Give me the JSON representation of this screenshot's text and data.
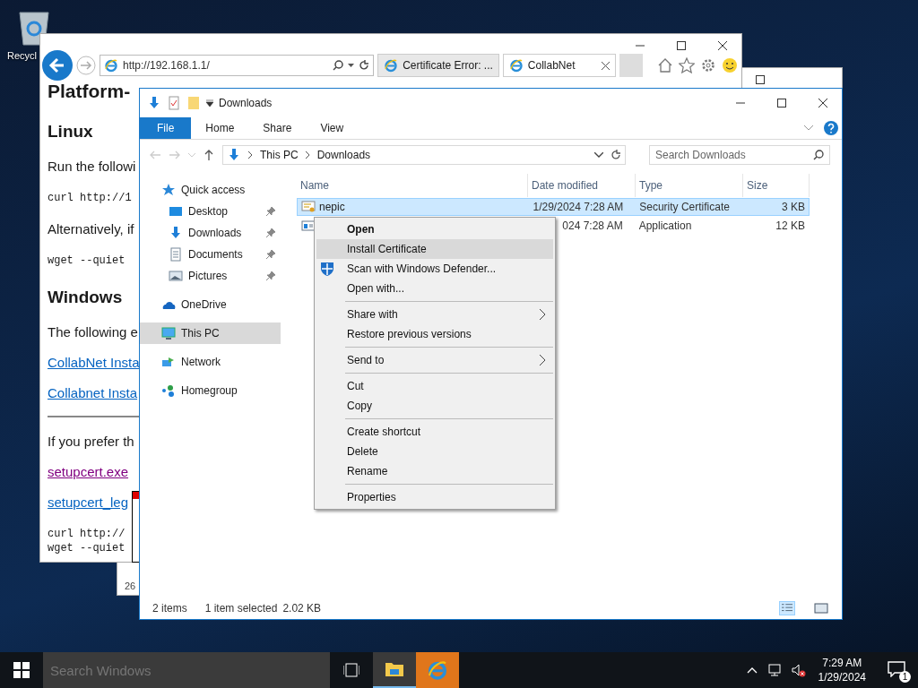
{
  "desktop": {
    "icons": [
      {
        "label": "Recycl"
      }
    ]
  },
  "browser": {
    "address": "http://192.168.1.1/",
    "tabs": [
      {
        "label": "Certificate Error: ...",
        "selected": false
      },
      {
        "label": "CollabNet",
        "selected": true
      }
    ],
    "page": [
      {
        "kind": "h1",
        "text": "Platform-"
      },
      {
        "kind": "h2",
        "text": "Linux"
      },
      {
        "kind": "p",
        "text": "Run the followi"
      },
      {
        "kind": "code",
        "text": "curl http://1"
      },
      {
        "kind": "p",
        "text": "Alternatively, if"
      },
      {
        "kind": "code",
        "text": "wget --quiet"
      },
      {
        "kind": "h2",
        "text": "Windows"
      },
      {
        "kind": "p",
        "text": "The following e"
      },
      {
        "kind": "link",
        "text": "CollabNet Insta",
        "visited": false
      },
      {
        "kind": "link",
        "text": "Collabnet Insta",
        "visited": false
      },
      {
        "kind": "hr"
      },
      {
        "kind": "p",
        "text": "If you prefer th"
      },
      {
        "kind": "link",
        "text": "setupcert.exe",
        "visited": true
      },
      {
        "kind": "link",
        "text": "setupcert_leg",
        "visited": false
      },
      {
        "kind": "code",
        "text": "curl http://"
      },
      {
        "kind": "code",
        "text": "wget --quiet"
      }
    ]
  },
  "background_window": {
    "status": "26"
  },
  "explorer": {
    "title": "Downloads",
    "ribbon_tabs": [
      {
        "label": "File",
        "selected": true
      },
      {
        "label": "Home",
        "selected": false
      },
      {
        "label": "Share",
        "selected": false
      },
      {
        "label": "View",
        "selected": false
      }
    ],
    "breadcrumb": [
      "This PC",
      "Downloads"
    ],
    "search": {
      "placeholder": "Search Downloads"
    },
    "nav": [
      {
        "label": "Quick access",
        "pinned": false,
        "selected": false,
        "children": [
          {
            "label": "Desktop",
            "pinned": true,
            "selected": false
          },
          {
            "label": "Downloads",
            "pinned": true,
            "selected": false
          },
          {
            "label": "Documents",
            "pinned": true,
            "selected": false
          },
          {
            "label": "Pictures",
            "pinned": true,
            "selected": false
          }
        ]
      },
      {
        "label": "OneDrive",
        "pinned": false,
        "selected": false
      },
      {
        "label": "This PC",
        "pinned": false,
        "selected": true
      },
      {
        "label": "Network",
        "pinned": false,
        "selected": false
      },
      {
        "label": "Homegroup",
        "pinned": false,
        "selected": false
      }
    ],
    "columns": [
      "Name",
      "Date modified",
      "Type",
      "Size"
    ],
    "rows": [
      {
        "kind": "certificate",
        "name": "nepic",
        "date": "1/29/2024 7:28 AM",
        "type": "Security Certificate",
        "size": "3 KB",
        "selected": true
      },
      {
        "kind": "application",
        "date": "024 7:28 AM",
        "type": "Application",
        "size": "12 KB",
        "selected": false
      }
    ],
    "status": {
      "count": "2 items",
      "selection": "1 item selected",
      "selection_size": "2.02 KB"
    },
    "views": [
      {
        "kind": "details",
        "selected": true
      },
      {
        "kind": "tiles",
        "selected": false
      }
    ]
  },
  "context_menu": {
    "items": [
      {
        "kind": "item",
        "label": "Open",
        "bold": true,
        "highlighted": false
      },
      {
        "kind": "item",
        "label": "Install Certificate",
        "bold": false,
        "highlighted": true
      },
      {
        "kind": "item",
        "label": "Scan with Windows Defender...",
        "bold": false,
        "highlighted": false,
        "icon": true
      },
      {
        "kind": "item",
        "label": "Open with...",
        "bold": false,
        "highlighted": false
      },
      {
        "kind": "separator"
      },
      {
        "kind": "item",
        "label": "Share with",
        "bold": false,
        "highlighted": false,
        "submenu": true
      },
      {
        "kind": "item",
        "label": "Restore previous versions",
        "bold": false,
        "highlighted": false
      },
      {
        "kind": "separator"
      },
      {
        "kind": "item",
        "label": "Send to",
        "bold": false,
        "highlighted": false,
        "submenu": true
      },
      {
        "kind": "separator"
      },
      {
        "kind": "item",
        "label": "Cut",
        "bold": false,
        "highlighted": false
      },
      {
        "kind": "item",
        "label": "Copy",
        "bold": false,
        "highlighted": false
      },
      {
        "kind": "separator"
      },
      {
        "kind": "item",
        "label": "Create shortcut",
        "bold": false,
        "highlighted": false
      },
      {
        "kind": "item",
        "label": "Delete",
        "bold": false,
        "highlighted": false
      },
      {
        "kind": "item",
        "label": "Rename",
        "bold": false,
        "highlighted": false
      },
      {
        "kind": "separator"
      },
      {
        "kind": "item",
        "label": "Properties",
        "bold": false,
        "highlighted": false
      }
    ]
  },
  "taskbar": {
    "search": {
      "placeholder": "Search Windows"
    },
    "apps": [
      {
        "kind": "explorer",
        "active": true
      },
      {
        "kind": "browser",
        "active": false
      }
    ],
    "time": "7:29 AM",
    "date": "1/29/2024",
    "notifications": "1"
  }
}
